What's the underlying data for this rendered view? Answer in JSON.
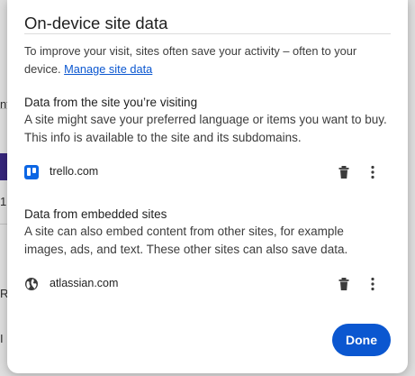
{
  "background": {
    "glyphs": [
      "nt",
      "1",
      "R",
      "I"
    ]
  },
  "dialog": {
    "title": "On-device site data",
    "description": "To improve your visit, sites often save your activity – often to your device.",
    "manage_link": "Manage site data",
    "sections": [
      {
        "title": "Data from the site you’re visiting",
        "description": "A site might save your preferred language or items you want to buy. This info is available to the site and its subdomains.",
        "site": {
          "name": "trello.com",
          "icon": "trello-icon"
        }
      },
      {
        "title": "Data from embedded sites",
        "description": "A site can also embed content from other sites, for example images, ads, and text. These other sites can also save data.",
        "site": {
          "name": "atlassian.com",
          "icon": "globe-icon"
        }
      }
    ],
    "done_label": "Done"
  },
  "colors": {
    "accent": "#0b57d0",
    "trello_brand": "#0c66e4",
    "background_band": "#3b2a86"
  }
}
